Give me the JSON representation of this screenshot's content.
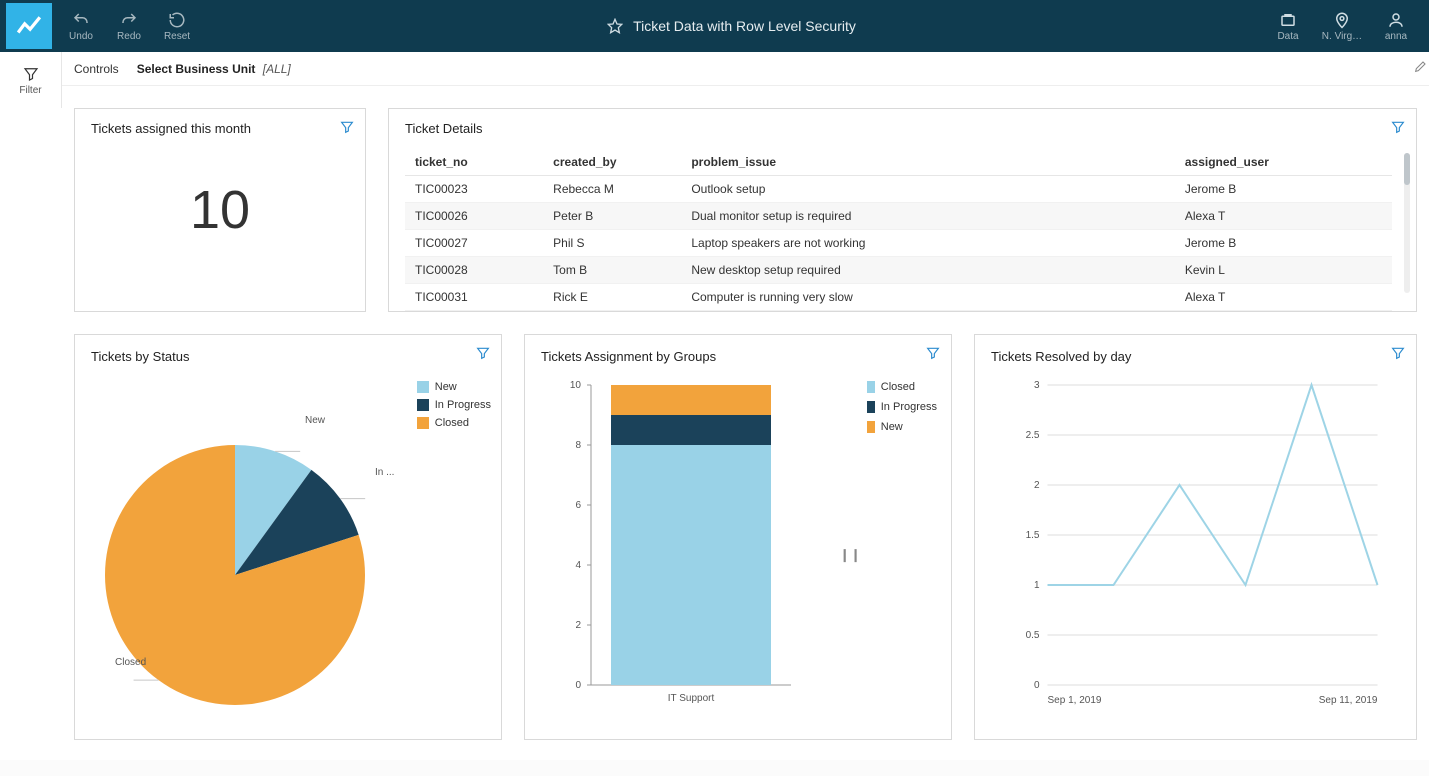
{
  "topbar": {
    "undo": "Undo",
    "redo": "Redo",
    "reset": "Reset",
    "title": "Ticket Data with Row Level Security",
    "data_label": "Data",
    "region_label": "N. Virg…",
    "user_label": "anna"
  },
  "filter_label": "Filter",
  "controls": {
    "label": "Controls",
    "selector_label": "Select Business Unit",
    "selector_value": "[ALL]"
  },
  "cards": {
    "metric": {
      "title": "Tickets assigned this month",
      "value": "10"
    },
    "details": {
      "title": "Ticket Details",
      "columns": [
        "ticket_no",
        "created_by",
        "problem_issue",
        "assigned_user"
      ],
      "rows": [
        [
          "TIC00023",
          "Rebecca M",
          "Outlook setup",
          "Jerome B"
        ],
        [
          "TIC00026",
          "Peter B",
          "Dual monitor setup is required",
          "Alexa T"
        ],
        [
          "TIC00027",
          "Phil S",
          "Laptop speakers are not working",
          "Jerome B"
        ],
        [
          "TIC00028",
          "Tom B",
          "New desktop setup required",
          "Kevin L"
        ],
        [
          "TIC00031",
          "Rick E",
          "Computer is running very slow",
          "Alexa T"
        ]
      ]
    },
    "pie": {
      "title": "Tickets by Status",
      "legend": [
        "New",
        "In Progress",
        "Closed"
      ],
      "labels": {
        "new": "New",
        "in_progress": "In ...",
        "closed": "Closed"
      }
    },
    "bar": {
      "title": "Tickets Assignment by Groups",
      "legend": [
        "Closed",
        "In Progress",
        "New"
      ],
      "xcat": "IT Support"
    },
    "line": {
      "title": "Tickets Resolved by day",
      "xstart": "Sep 1, 2019",
      "xend": "Sep 11, 2019"
    }
  },
  "colors": {
    "new": "#99d2e7",
    "in_progress": "#1b425a",
    "closed": "#f2a33c",
    "line": "#9ed4e6"
  },
  "chart_data": [
    {
      "type": "pie",
      "title": "Tickets by Status",
      "categories": [
        "New",
        "In Progress",
        "Closed"
      ],
      "values": [
        1,
        1,
        8
      ]
    },
    {
      "type": "bar",
      "title": "Tickets Assignment by Groups",
      "categories": [
        "IT Support"
      ],
      "series": [
        {
          "name": "Closed",
          "values": [
            8
          ]
        },
        {
          "name": "In Progress",
          "values": [
            1
          ]
        },
        {
          "name": "New",
          "values": [
            1
          ]
        }
      ],
      "ylim": [
        0,
        10
      ],
      "stacked": true
    },
    {
      "type": "line",
      "title": "Tickets Resolved by day",
      "x": [
        "Sep 1, 2019",
        "Sep 3, 2019",
        "Sep 5, 2019",
        "Sep 7, 2019",
        "Sep 9, 2019",
        "Sep 11, 2019"
      ],
      "values": [
        1,
        1,
        2,
        1,
        3,
        1
      ],
      "ylim": [
        0,
        3
      ],
      "xlabel": "",
      "ylabel": ""
    }
  ]
}
